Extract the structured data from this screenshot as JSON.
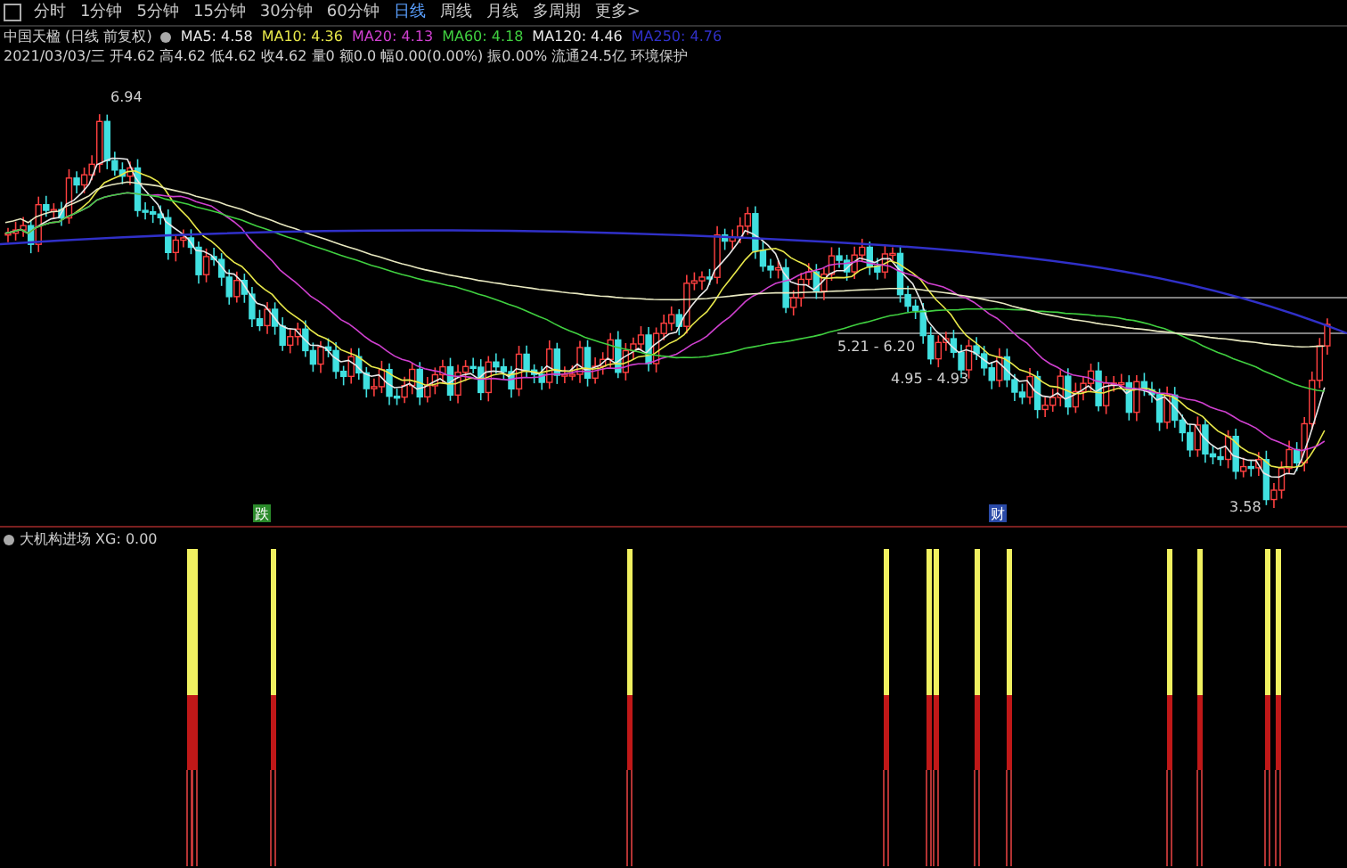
{
  "period_tabs": [
    {
      "label": "分时",
      "selected": false
    },
    {
      "label": "1分钟",
      "selected": false
    },
    {
      "label": "5分钟",
      "selected": false
    },
    {
      "label": "15分钟",
      "selected": false
    },
    {
      "label": "30分钟",
      "selected": false
    },
    {
      "label": "60分钟",
      "selected": false
    },
    {
      "label": "日线",
      "selected": true
    },
    {
      "label": "周线",
      "selected": false
    },
    {
      "label": "月线",
      "selected": false
    },
    {
      "label": "多周期",
      "selected": false
    },
    {
      "label": "更多>",
      "selected": false
    }
  ],
  "stock_title": "中国天楹 (日线 前复权)",
  "moving_averages": [
    {
      "label": "MA5: 4.58",
      "color": "#e8e8e8"
    },
    {
      "label": "MA10: 4.36",
      "color": "#e8e84a"
    },
    {
      "label": "MA20: 4.13",
      "color": "#d040d0"
    },
    {
      "label": "MA60: 4.18",
      "color": "#40d040"
    },
    {
      "label": "MA120: 4.46",
      "color": "#e8e8e8"
    },
    {
      "label": "MA250: 4.76",
      "color": "#3030c8"
    }
  ],
  "quote_line": "2021/03/03/三 开4.62 高4.62 低4.62 收4.62 量0 额0.0 幅0.00(0.00%) 振0.00% 流通24.5亿 环境保护",
  "price_marks": [
    {
      "label": "6.94"
    },
    {
      "label": "5.21 - 6.20"
    },
    {
      "label": "4.95 - 4.93"
    },
    {
      "label": "3.58"
    }
  ],
  "event_marks": [
    {
      "label": "跌",
      "color": "#2a8a2a"
    },
    {
      "label": "财",
      "color": "#2a4aa8"
    }
  ],
  "indicator_title": "大机构进场 XG: 0.00"
}
